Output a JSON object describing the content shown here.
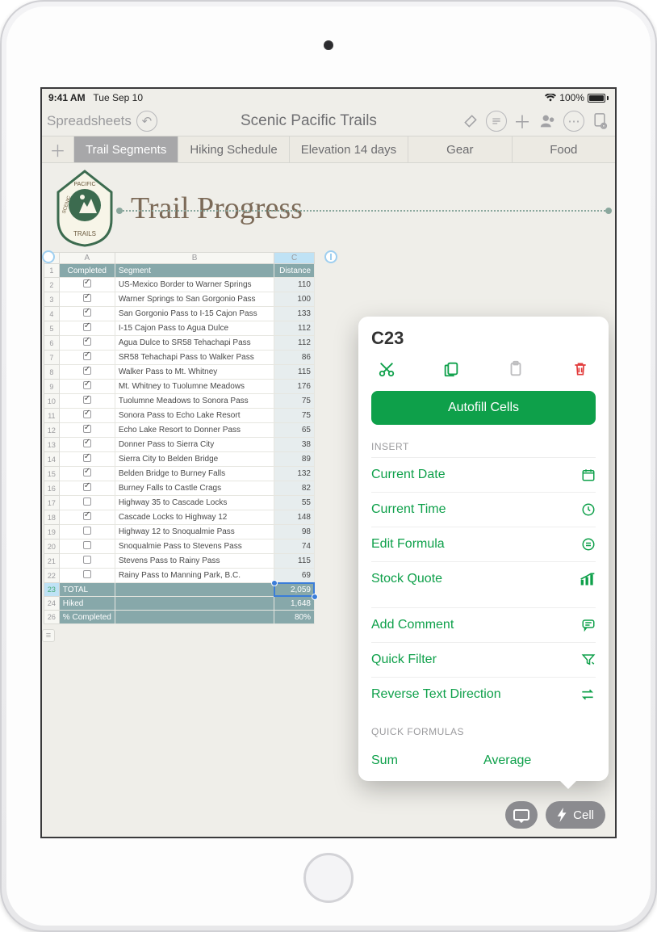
{
  "status": {
    "time": "9:41 AM",
    "date": "Tue Sep 10",
    "battery": "100%"
  },
  "toolbar": {
    "back": "Spreadsheets",
    "title": "Scenic Pacific Trails"
  },
  "tabs": [
    "Trail Segments",
    "Hiking Schedule",
    "Elevation 14 days",
    "Gear",
    "Food"
  ],
  "active_tab": 0,
  "doc_title": "Trail Progress",
  "logo": {
    "top": "SCENIC",
    "mid": "PACIFIC",
    "bot": "TRAILS"
  },
  "columns": [
    "A",
    "B",
    "C"
  ],
  "headers": {
    "a": "Completed",
    "b": "Segment",
    "c": "Distance"
  },
  "rows": [
    {
      "n": 2,
      "done": true,
      "seg": "US-Mexico Border to Warner Springs",
      "dist": 110
    },
    {
      "n": 3,
      "done": true,
      "seg": "Warner Springs to San Gorgonio Pass",
      "dist": 100
    },
    {
      "n": 4,
      "done": true,
      "seg": "San Gorgonio Pass to I-15 Cajon Pass",
      "dist": 133
    },
    {
      "n": 5,
      "done": true,
      "seg": "I-15 Cajon Pass to Agua Dulce",
      "dist": 112
    },
    {
      "n": 6,
      "done": true,
      "seg": "Agua Dulce to SR58 Tehachapi Pass",
      "dist": 112
    },
    {
      "n": 7,
      "done": true,
      "seg": "SR58 Tehachapi Pass to Walker Pass",
      "dist": 86
    },
    {
      "n": 8,
      "done": true,
      "seg": "Walker Pass to Mt. Whitney",
      "dist": 115
    },
    {
      "n": 9,
      "done": true,
      "seg": "Mt. Whitney to Tuolumne Meadows",
      "dist": 176
    },
    {
      "n": 10,
      "done": true,
      "seg": "Tuolumne Meadows to Sonora Pass",
      "dist": 75
    },
    {
      "n": 11,
      "done": true,
      "seg": "Sonora Pass to Echo Lake Resort",
      "dist": 75
    },
    {
      "n": 12,
      "done": true,
      "seg": "Echo Lake Resort to Donner Pass",
      "dist": 65
    },
    {
      "n": 13,
      "done": true,
      "seg": "Donner Pass to Sierra City",
      "dist": 38
    },
    {
      "n": 14,
      "done": true,
      "seg": "Sierra City to Belden Bridge",
      "dist": 89
    },
    {
      "n": 15,
      "done": true,
      "seg": "Belden Bridge to Burney Falls",
      "dist": 132
    },
    {
      "n": 16,
      "done": true,
      "seg": "Burney Falls to Castle Crags",
      "dist": 82
    },
    {
      "n": 17,
      "done": false,
      "seg": "Highway 35 to Cascade Locks",
      "dist": 55
    },
    {
      "n": 18,
      "done": true,
      "seg": "Cascade Locks to Highway 12",
      "dist": 148
    },
    {
      "n": 19,
      "done": false,
      "seg": "Highway 12 to Snoqualmie Pass",
      "dist": 98
    },
    {
      "n": 20,
      "done": false,
      "seg": "Snoqualmie Pass to Stevens Pass",
      "dist": 74
    },
    {
      "n": 21,
      "done": false,
      "seg": "Stevens Pass to Rainy Pass",
      "dist": 115
    },
    {
      "n": 22,
      "done": false,
      "seg": "Rainy Pass to Manning Park, B.C.",
      "dist": 69
    }
  ],
  "summary": [
    {
      "n": 23,
      "label": "TOTAL",
      "value": "2,059"
    },
    {
      "n": 24,
      "label": "Hiked",
      "value": "1,648"
    },
    {
      "n": 26,
      "label": "% Completed",
      "value": "80%"
    }
  ],
  "selected_cell": "C23",
  "popover": {
    "cell": "C23",
    "autofill": "Autofill Cells",
    "insert_label": "INSERT",
    "insert": [
      "Current Date",
      "Current Time",
      "Edit Formula",
      "Stock Quote"
    ],
    "actions": [
      "Add Comment",
      "Quick Filter",
      "Reverse Text Direction"
    ],
    "qf_label": "QUICK FORMULAS",
    "qf": [
      "Sum",
      "Average"
    ]
  },
  "pills": {
    "cell": "Cell"
  },
  "colors": {
    "accent": "#0ea04a",
    "selection": "#3b7dd8",
    "teal": "#87a8aa"
  }
}
